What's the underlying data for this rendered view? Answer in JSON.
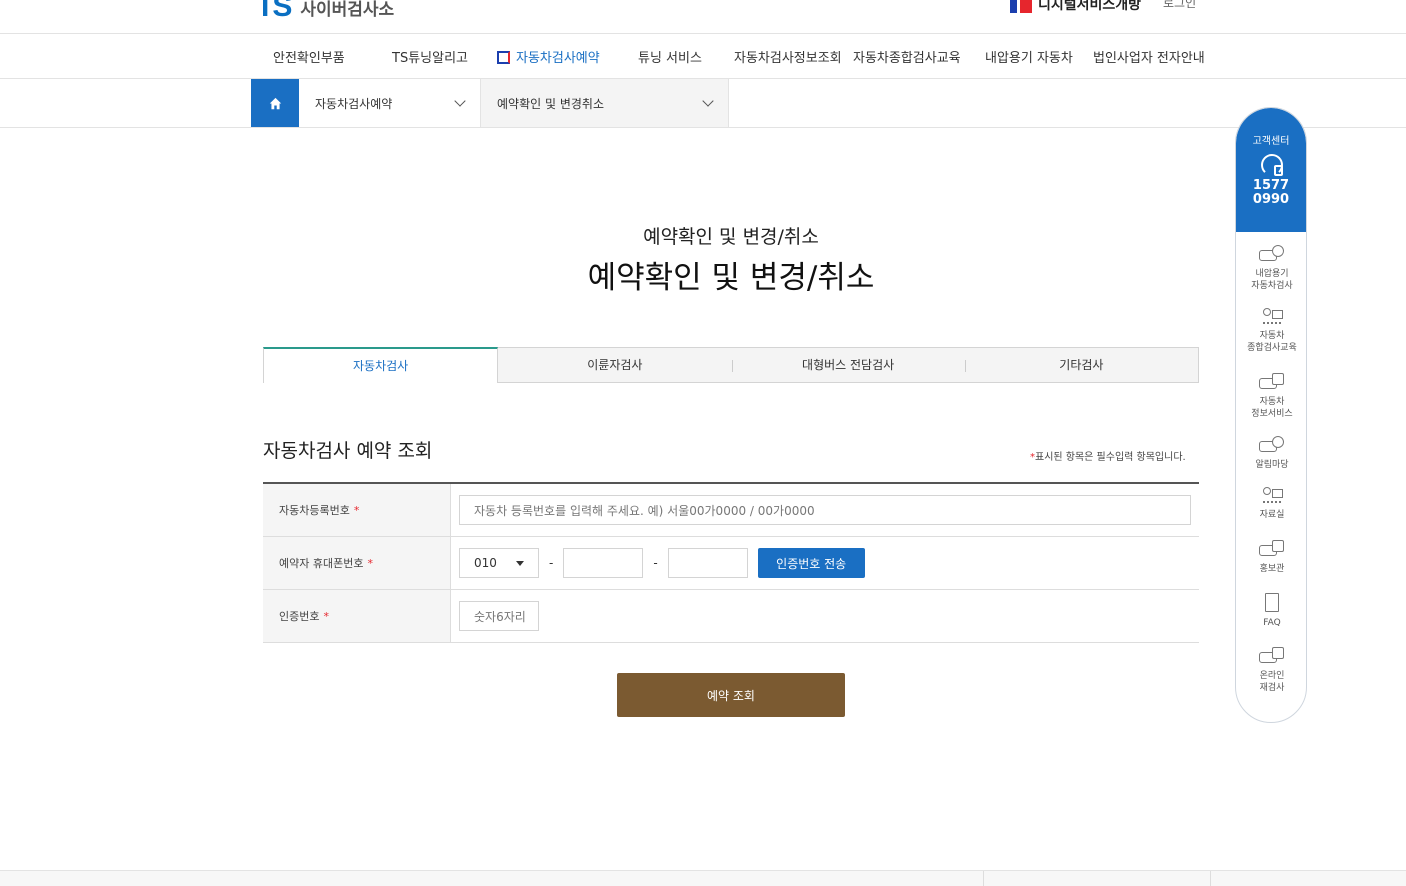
{
  "header": {
    "logo_mark": "TS",
    "logo_text": "사이버검사소",
    "digital_gov": "디지털서비스개방",
    "login": "로그인"
  },
  "gnb": {
    "items": [
      {
        "label": "안전확인부품"
      },
      {
        "label": "TS튜닝알리고"
      },
      {
        "label": "자동차검사예약"
      },
      {
        "label": "튜닝 서비스"
      },
      {
        "label": "자동차검사정보조회"
      },
      {
        "label": "자동차종합검사교육"
      },
      {
        "label": "내압용기 자동차"
      },
      {
        "label": "법인사업자 전자안내"
      }
    ]
  },
  "breadcrumb": {
    "level1": "자동차검사예약",
    "level2": "예약확인 및 변경취소"
  },
  "page": {
    "sub_title": "예약확인 및 변경/취소",
    "main_title": "예약확인 및 변경/취소"
  },
  "tabs": [
    {
      "label": "자동차검사",
      "active": true
    },
    {
      "label": "이륜자검사"
    },
    {
      "label": "대형버스 전담검사"
    },
    {
      "label": "기타검사"
    }
  ],
  "form": {
    "title": "자동차검사 예약 조회",
    "required_note_star": "*",
    "required_note": "표시된 항목은 필수입력 항목입니다.",
    "required_mark": "*",
    "plate_label": "자동차등록번호",
    "plate_placeholder": "자동차 등록번호를 입력해 주세요. 예) 서울00가0000 / 00가0000",
    "phone_label": "예약자 휴대폰번호",
    "phone_prefix": "010",
    "dash": "-",
    "send_button": "인증번호 전송",
    "code_label": "인증번호",
    "code_placeholder": "숫자6자리",
    "search_button": "예약 조회"
  },
  "quick_menu": {
    "label": "고객센터",
    "tel_line1": "1577",
    "tel_line2": "0990",
    "items": [
      {
        "line1": "내압용기",
        "line2": "자동차검사",
        "icon": "truck-icon"
      },
      {
        "line1": "자동차",
        "line2": "종합검사교육",
        "icon": "education-icon"
      },
      {
        "line1": "자동차",
        "line2": "정보서비스",
        "icon": "car-info-icon"
      },
      {
        "line1": "알림마당",
        "line2": "",
        "icon": "notice-icon"
      },
      {
        "line1": "자료실",
        "line2": "",
        "icon": "archive-icon"
      },
      {
        "line1": "홍보관",
        "line2": "",
        "icon": "promotion-icon"
      },
      {
        "line1": "FAQ",
        "line2": "",
        "icon": "faq-icon"
      },
      {
        "line1": "온라인",
        "line2": "재검사",
        "icon": "online-recheck-icon"
      }
    ]
  },
  "colors": {
    "primary": "#1a6fc3",
    "search_button": "#7b5a31",
    "tab_active_border": "#2a9a8c",
    "required": "#e6262d"
  }
}
